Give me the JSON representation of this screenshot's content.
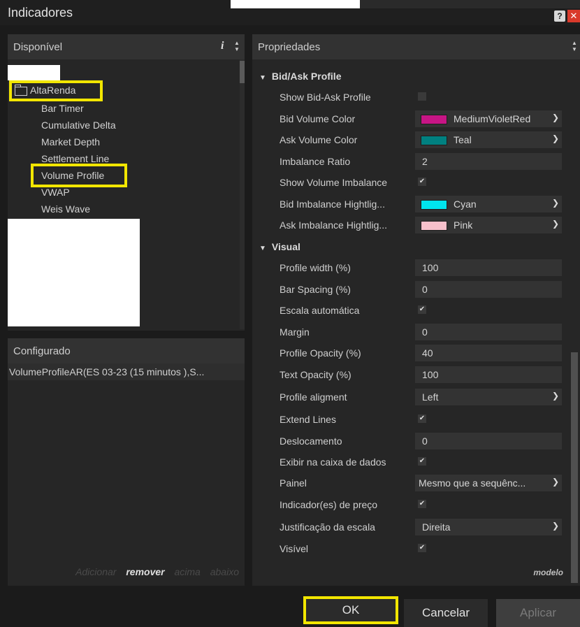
{
  "window": {
    "title": "Indicadores",
    "help_label": "?",
    "close_label": "✕"
  },
  "available": {
    "header": "Disponível",
    "info_label": "i",
    "folder": "AltaRenda",
    "items": [
      "Bar Timer",
      "Cumulative Delta",
      "Market Depth",
      "Settlement Line",
      "Volume Profile",
      "VWAP",
      "Weis Wave"
    ]
  },
  "configured": {
    "header": "Configurado",
    "item": "VolumeProfileAR(ES 03-23 (15 minutos ),S...",
    "actions": {
      "add": "Adicionar",
      "remove": "remover",
      "up": "acima",
      "down": "abaixo"
    }
  },
  "properties": {
    "header": "Propriedades",
    "section_bidask": "Bid/Ask Profile",
    "section_visual": "Visual",
    "template_label": "modelo",
    "rows": {
      "show_bid_ask": {
        "label": "Show Bid-Ask Profile",
        "checked": false
      },
      "bid_volume_color": {
        "label": "Bid Volume Color",
        "value": "MediumVioletRed",
        "color": "#c71585"
      },
      "ask_volume_color": {
        "label": "Ask Volume Color",
        "value": "Teal",
        "color": "#008080"
      },
      "imbalance_ratio": {
        "label": "Imbalance Ratio",
        "value": "2"
      },
      "show_volume_imbalance": {
        "label": "Show Volume Imbalance",
        "checked": true
      },
      "bid_imbalance_highlight": {
        "label": "Bid Imbalance Hightlig...",
        "value": "Cyan",
        "color": "#00e5ee"
      },
      "ask_imbalance_highlight": {
        "label": "Ask Imbalance Hightlig...",
        "value": "Pink",
        "color": "#f7c0cb"
      },
      "profile_width": {
        "label": "Profile width (%)",
        "value": "100"
      },
      "bar_spacing": {
        "label": "Bar Spacing (%)",
        "value": "0"
      },
      "escala_automatica": {
        "label": "Escala automática",
        "checked": true
      },
      "margin": {
        "label": "Margin",
        "value": "0"
      },
      "profile_opacity": {
        "label": "Profile Opacity (%)",
        "value": "40"
      },
      "text_opacity": {
        "label": "Text Opacity (%)",
        "value": "100"
      },
      "profile_alignment": {
        "label": "Profile aligment",
        "value": "Left"
      },
      "extend_lines": {
        "label": "Extend Lines",
        "checked": true
      },
      "deslocamento": {
        "label": "Deslocamento",
        "value": "0"
      },
      "exibir_caixa": {
        "label": "Exibir na caixa de dados",
        "checked": true
      },
      "painel": {
        "label": "Painel",
        "value": "Mesmo que a sequênc..."
      },
      "indicador_preco": {
        "label": "Indicador(es) de preço",
        "checked": true
      },
      "justificacao": {
        "label": "Justificação da escala",
        "value": "Direita"
      },
      "visivel": {
        "label": "Visível",
        "checked": true
      }
    }
  },
  "buttons": {
    "ok": "OK",
    "cancel": "Cancelar",
    "apply": "Aplicar"
  },
  "colors": {
    "highlight": "#f2e600"
  }
}
